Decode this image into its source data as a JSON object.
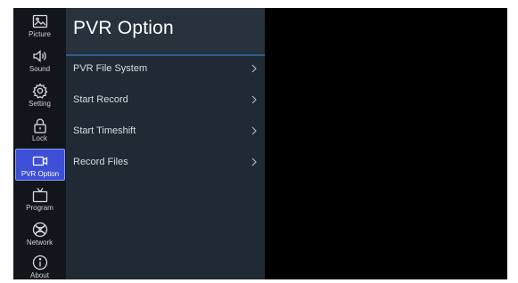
{
  "rail": {
    "items": [
      {
        "label": "Picture",
        "icon": "picture-icon"
      },
      {
        "label": "Sound",
        "icon": "speaker-icon"
      },
      {
        "label": "Setting",
        "icon": "gear-icon"
      },
      {
        "label": "Lock",
        "icon": "lock-icon"
      },
      {
        "label": "PVR Option",
        "icon": "camera-icon",
        "active": true
      },
      {
        "label": "Program",
        "icon": "tv-icon"
      },
      {
        "label": "Network",
        "icon": "globe-icon"
      },
      {
        "label": "About",
        "icon": "info-icon"
      }
    ],
    "active_color": "#3d4fd6"
  },
  "panel": {
    "title": "PVR Option",
    "items": [
      {
        "label": "PVR File System",
        "icon": "chevron-right-icon"
      },
      {
        "label": "Start Record",
        "icon": "chevron-right-icon"
      },
      {
        "label": "Start Timeshift",
        "icon": "chevron-right-icon"
      },
      {
        "label": "Record Files",
        "icon": "chevron-right-icon"
      }
    ]
  }
}
